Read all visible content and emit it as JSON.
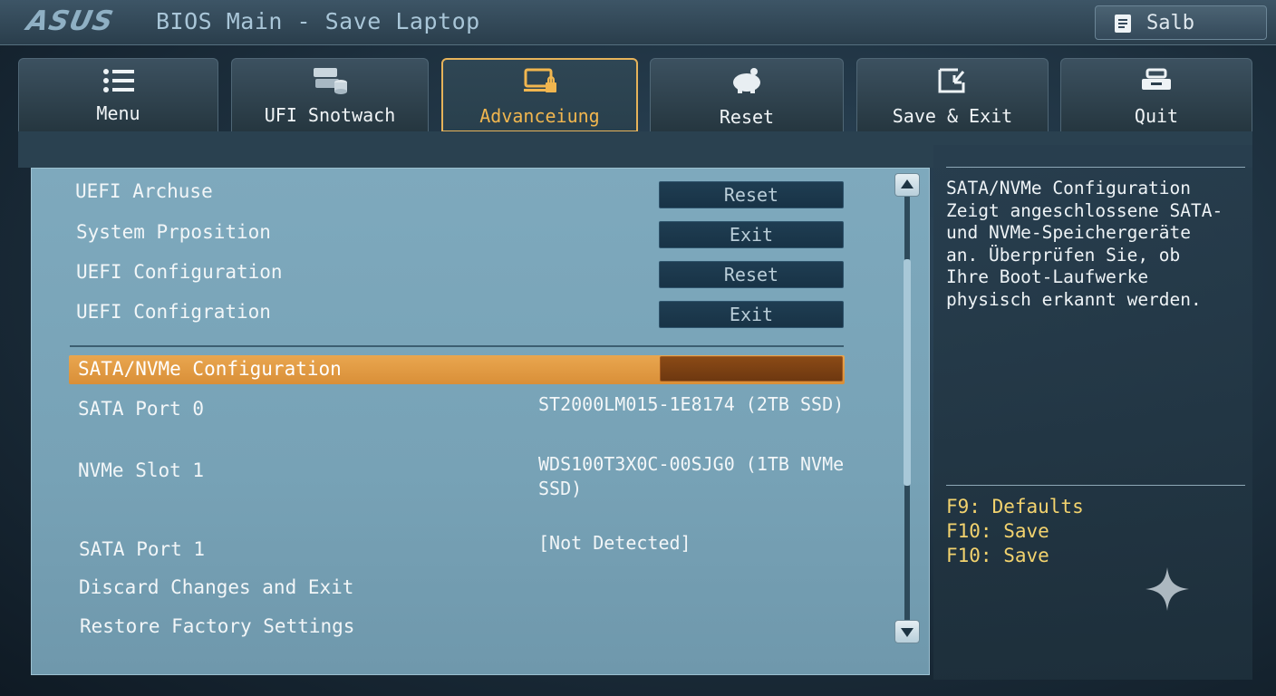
{
  "header": {
    "logo": "ASUS",
    "title": "BIOS Main - Save Laptop",
    "user_label": "Salb"
  },
  "tabs": [
    {
      "label": "Menu",
      "icon": "list-icon",
      "active": false
    },
    {
      "label": "UFI Snotwach",
      "icon": "database-icon",
      "active": false
    },
    {
      "label": "Advanceiung",
      "icon": "monitor-lock-icon",
      "active": true
    },
    {
      "label": "Reset",
      "icon": "piggy-bank-icon",
      "active": false
    },
    {
      "label": "Save & Exit",
      "icon": "save-exit-icon",
      "active": false
    },
    {
      "label": "Quit",
      "icon": "tray-icon",
      "active": false
    }
  ],
  "menu": {
    "items": [
      {
        "label": "UEFI Archuse",
        "button": "Reset"
      },
      {
        "label": "System Prposition",
        "button": "Exit"
      },
      {
        "label": "UEFI Configuration",
        "button": "Reset"
      },
      {
        "label": "UEFI Configration",
        "button": "Exit"
      }
    ],
    "selected": {
      "label": "SATA/NVMe Configuration"
    },
    "details": [
      {
        "label": "SATA Port 0",
        "value": "ST2000LM015-1E8174 (2TB SSD)"
      },
      {
        "label": "NVMe Slot 1",
        "value": "WDS100T3X0C-00SJG0 (1TB NVMe SSD)"
      },
      {
        "label": "SATA Port 1",
        "value": "[Not Detected]"
      }
    ],
    "actions": [
      {
        "label": "Discard Changes and Exit"
      },
      {
        "label": "Restore Factory Settings"
      }
    ]
  },
  "help": {
    "description": "SATA/NVMe Configuration\nZeigt angeschlossene SATA-\nund NVMe-Speichergeräte\nan. Überprüfen Sie, ob\nIhre Boot-Laufwerke\nphysisch erkannt werden.",
    "keys": [
      "F9: Defaults",
      "F10: Save",
      "F10: Save"
    ]
  },
  "colors": {
    "accent": "#e6b35a",
    "highlight": "#e39b45",
    "key_text": "#f3d36e"
  }
}
